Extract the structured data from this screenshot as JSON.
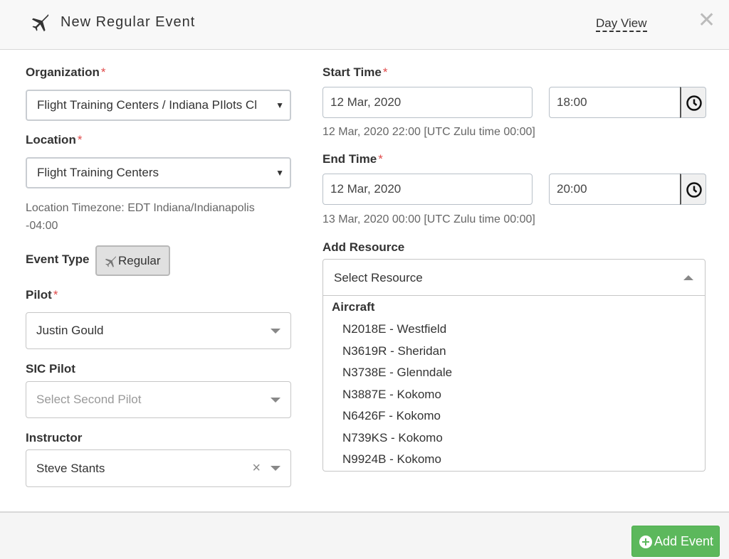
{
  "header": {
    "title": "New Regular Event",
    "day_view": "Day View",
    "close": "✕"
  },
  "organization": {
    "label": "Organization",
    "required": "*",
    "value": "Flight Training Centers / Indiana PIlots Cl"
  },
  "location": {
    "label": "Location",
    "required": "*",
    "value": "Flight Training Centers",
    "timezone_line1": "Location Timezone: EDT Indiana/Indianapolis",
    "timezone_line2": "-04:00"
  },
  "event_type": {
    "label": "Event Type",
    "button": "Regular"
  },
  "pilot": {
    "label": "Pilot",
    "required": "*",
    "value": "Justin Gould"
  },
  "sic_pilot": {
    "label": "SIC Pilot",
    "placeholder": "Select Second Pilot"
  },
  "instructor": {
    "label": "Instructor",
    "value": "Steve Stants",
    "clear": "×"
  },
  "start_time": {
    "label": "Start Time",
    "required": "*",
    "date": "12 Mar, 2020",
    "time": "18:00",
    "zulu": "12 Mar, 2020 22:00 [UTC Zulu time 00:00]"
  },
  "end_time": {
    "label": "End Time",
    "required": "*",
    "date": "12 Mar, 2020",
    "time": "20:00",
    "zulu": "13 Mar, 2020 00:00 [UTC Zulu time 00:00]"
  },
  "add_resource": {
    "label": "Add Resource",
    "placeholder": "Select Resource",
    "group": "Aircraft",
    "items": [
      "N2018E - Westfield",
      "N3619R - Sheridan",
      "N3738E - Glenndale",
      "N3887E - Kokomo",
      "N6426F - Kokomo",
      "N739KS - Kokomo",
      "N9924B - Kokomo"
    ]
  },
  "footer": {
    "add_event": "Add Event"
  },
  "colors": {
    "required": "#e04a4a",
    "add_button": "#5cb85c"
  }
}
